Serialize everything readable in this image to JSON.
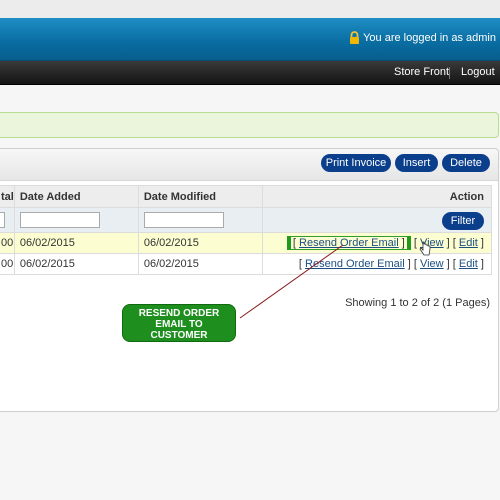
{
  "header": {
    "login_text": "You are logged in as admin"
  },
  "nav": {
    "store_front": "Store Front",
    "logout": "Logout"
  },
  "toolbar": {
    "print_invoice": "Print Invoice",
    "insert": "Insert",
    "delete": "Delete"
  },
  "table": {
    "columns": {
      "total": "tal",
      "date_added": "Date Added",
      "date_modified": "Date Modified",
      "action": "Action"
    },
    "filter_button": "Filter",
    "rows": [
      {
        "total": "00",
        "date_added": "06/02/2015",
        "date_modified": "06/02/2015",
        "highlighted": true
      },
      {
        "total": "00",
        "date_added": "06/02/2015",
        "date_modified": "06/02/2015",
        "highlighted": false
      }
    ],
    "action_links": {
      "resend": "Resend Order Email",
      "view": "View",
      "edit": "Edit"
    }
  },
  "pagination": "Showing 1 to 2 of 2 (1 Pages)",
  "callout": {
    "line1": "RESEND ORDER",
    "line2": "EMAIL TO",
    "line3": "CUSTOMER"
  },
  "colors": {
    "header_blue": "#0a6ea3",
    "button_navy": "#0b3f8c",
    "callout_green": "#1e8f1e",
    "pointer_line": "#8b1a1a"
  }
}
